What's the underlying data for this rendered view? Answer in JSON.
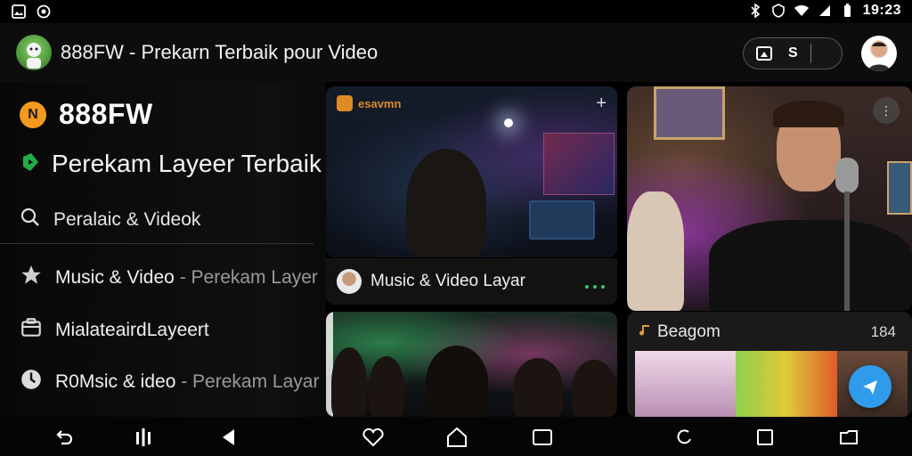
{
  "status_bar": {
    "time": "19:23",
    "left_icons": [
      "image-icon",
      "whatsapp-icon"
    ],
    "right_icons": [
      "bluetooth-icon",
      "nfc-icon",
      "wifi-icon",
      "signal-icon",
      "battery-icon"
    ]
  },
  "app_bar": {
    "title": "888FW - Prekarn Terbaik pour  Video",
    "actions": [
      {
        "name": "cast-button",
        "label": ""
      },
      {
        "name": "s-button",
        "label": "S"
      }
    ]
  },
  "sidebar": {
    "brand_icon_letter": "N",
    "brand": "888FW",
    "headline": "Perekam Layeer Terbaik our Music & Video",
    "search_label": "Peralaic & Videok",
    "items": [
      {
        "label_main": "Music & Video",
        "label_dim": " - Perekam Layer",
        "icon": "star-icon"
      },
      {
        "label_main": "MialateairdLayeert",
        "label_dim": "",
        "icon": "folder-icon"
      },
      {
        "label_main": "R0Msic & ideo",
        "label_dim": " - Perekam Layar",
        "icon": "clock-icon"
      }
    ]
  },
  "cards": {
    "card1": {
      "badge": "esavmn"
    },
    "card1_caption": {
      "text": "Music & Video Layar"
    },
    "card4": {
      "header": "Beagom",
      "count": "184"
    }
  },
  "colors": {
    "accent_orange": "#f39a1e",
    "fab_blue": "#2f9bea",
    "background": "#000000"
  }
}
